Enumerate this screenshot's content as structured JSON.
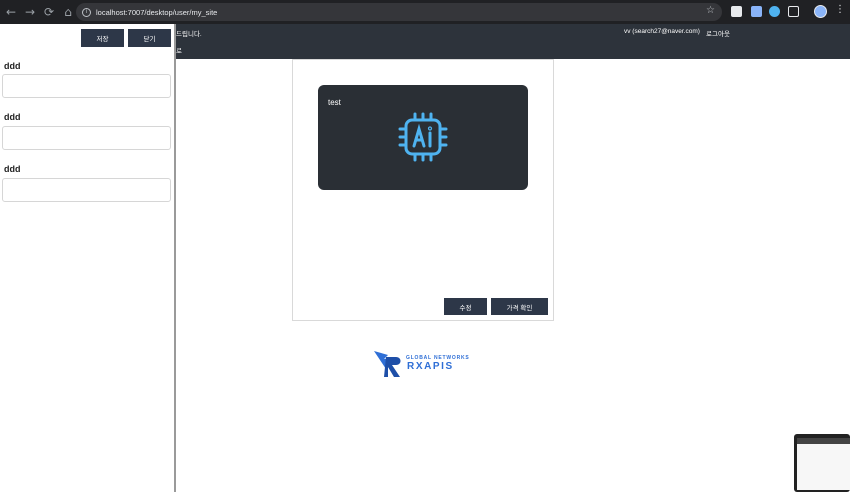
{
  "browser": {
    "url": "localhost:7007/desktop/user/my_site",
    "back_icon": "←",
    "forward_icon": "→",
    "reload_icon": "⟳",
    "home_icon": "⌂",
    "star_icon": "☆",
    "menu_icon": "⋮"
  },
  "header": {
    "welcome_text": "드립니다.",
    "sub_text": "로",
    "user_text": "vv (search27@naver.com)",
    "logout_label": "로그아웃"
  },
  "panel": {
    "save_label": "저장",
    "close_label": "닫기",
    "fields": [
      {
        "label": "ddd",
        "value": ""
      },
      {
        "label": "ddd",
        "value": ""
      },
      {
        "label": "ddd",
        "value": ""
      }
    ]
  },
  "main": {
    "card_title": "test",
    "card_icon": "ai-chip-icon",
    "edit_label": "수정",
    "price_label": "가격 확인"
  },
  "logo": {
    "tagline": "GLOBAL NETWORKS",
    "name": "RXAPIS"
  },
  "colors": {
    "header_bg": "#2d333b",
    "button_bg": "#2d3748",
    "card_bg": "#2a2f35",
    "icon_blue": "#4fb3f0",
    "logo_blue": "#2f6fd6"
  }
}
